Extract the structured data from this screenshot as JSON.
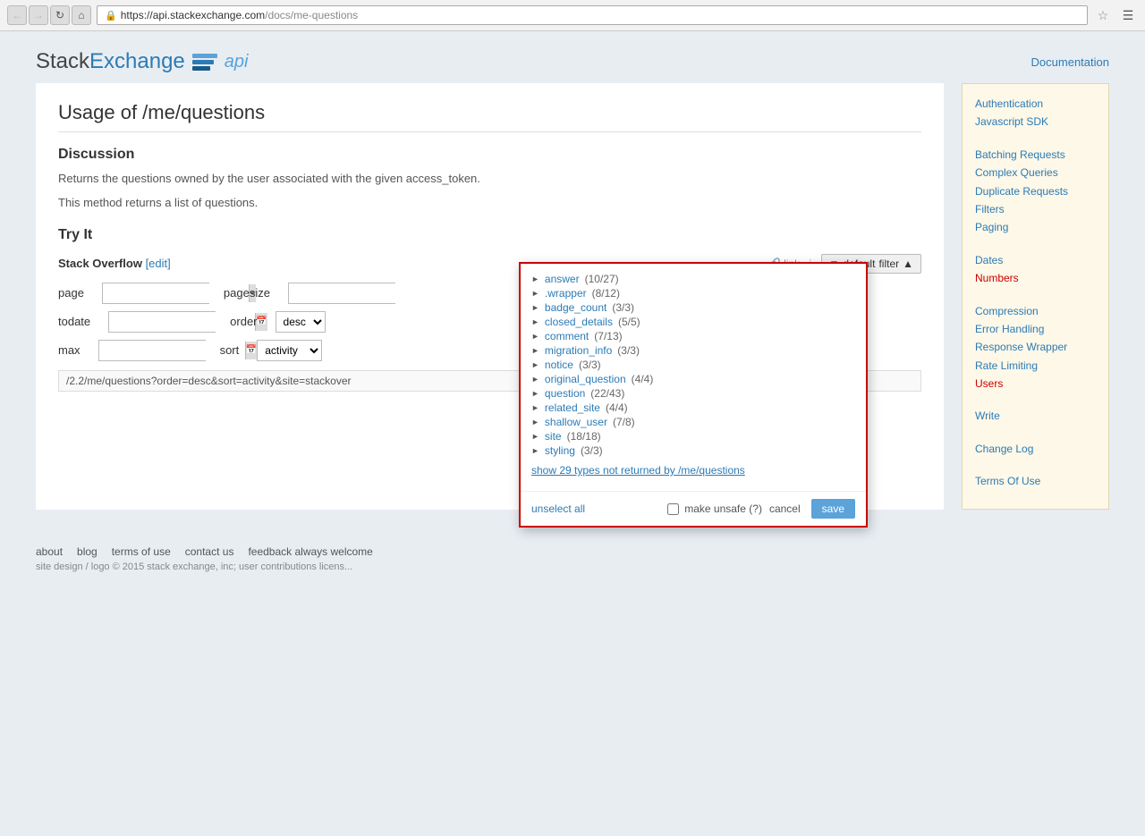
{
  "browser": {
    "url_base": "https://api.stackexchange.com",
    "url_path": "/docs/me-questions",
    "url_full": "https://api.stackexchange.com/docs/me-questions"
  },
  "header": {
    "logo_stack": "Stack",
    "logo_exchange": "Exchange",
    "logo_api": "api",
    "nav_link": "Documentation"
  },
  "page": {
    "title": "Usage of /me/questions",
    "discussion_title": "Discussion",
    "discussion_text1": "Returns the questions owned by the user associated with the given access_token.",
    "discussion_text2": "This method returns a list of questions.",
    "try_it_title": "Try It",
    "stack_overflow_label": "Stack Overflow",
    "edit_label": "[edit]",
    "link_label": "link",
    "default_label": "default",
    "filter_label": "filter",
    "page_label": "page",
    "pagesize_label": "pagesize",
    "todate_label": "todate",
    "order_label": "order",
    "max_label": "max",
    "sort_label": "sort",
    "order_value": "desc",
    "sort_value": "activity",
    "url_display": "/2.2/me/questions?order=desc&sort=activity&site=stackover"
  },
  "filter_dropdown": {
    "items": [
      {
        "name": "answer",
        "count": "(10/27)"
      },
      {
        "name": ".wrapper",
        "count": "(8/12)"
      },
      {
        "name": "badge_count",
        "count": "(3/3)"
      },
      {
        "name": "closed_details",
        "count": "(5/5)"
      },
      {
        "name": "comment",
        "count": "(7/13)"
      },
      {
        "name": "migration_info",
        "count": "(3/3)"
      },
      {
        "name": "notice",
        "count": "(3/3)"
      },
      {
        "name": "original_question",
        "count": "(4/4)"
      },
      {
        "name": "question",
        "count": "(22/43)"
      },
      {
        "name": "related_site",
        "count": "(4/4)"
      },
      {
        "name": "shallow_user",
        "count": "(7/8)"
      },
      {
        "name": "site",
        "count": "(18/18)"
      },
      {
        "name": "styling",
        "count": "(3/3)"
      }
    ],
    "show_more": "show 29 types not returned by /me/questions",
    "make_unsafe_label": "make unsafe (?)",
    "unselect_all_label": "unselect all",
    "cancel_label": "cancel",
    "save_label": "save"
  },
  "sidebar": {
    "items_group1": [
      {
        "label": "Authentication"
      },
      {
        "label": "Javascript SDK"
      }
    ],
    "items_group2": [
      {
        "label": "Batching Requests"
      },
      {
        "label": "Complex Queries"
      },
      {
        "label": "Duplicate Requests"
      },
      {
        "label": "Filters"
      },
      {
        "label": "Paging"
      }
    ],
    "items_group3": [
      {
        "label": "Dates"
      },
      {
        "label": "Numbers"
      }
    ],
    "items_group4": [
      {
        "label": "Compression"
      },
      {
        "label": "Error Handling"
      },
      {
        "label": "Response Wrapper"
      },
      {
        "label": "Rate Limiting"
      },
      {
        "label": "Users"
      }
    ],
    "items_group5": [
      {
        "label": "Write"
      }
    ],
    "items_group6": [
      {
        "label": "Change Log"
      }
    ],
    "items_group7": [
      {
        "label": "Terms Of Use"
      }
    ]
  },
  "footer": {
    "about": "about",
    "blog": "blog",
    "terms_of_use": "terms of use",
    "contact_us": "contact us",
    "feedback": "feedback always welcome",
    "copyright": "site design / logo © 2015 stack exchange, inc; user contributions licens..."
  }
}
